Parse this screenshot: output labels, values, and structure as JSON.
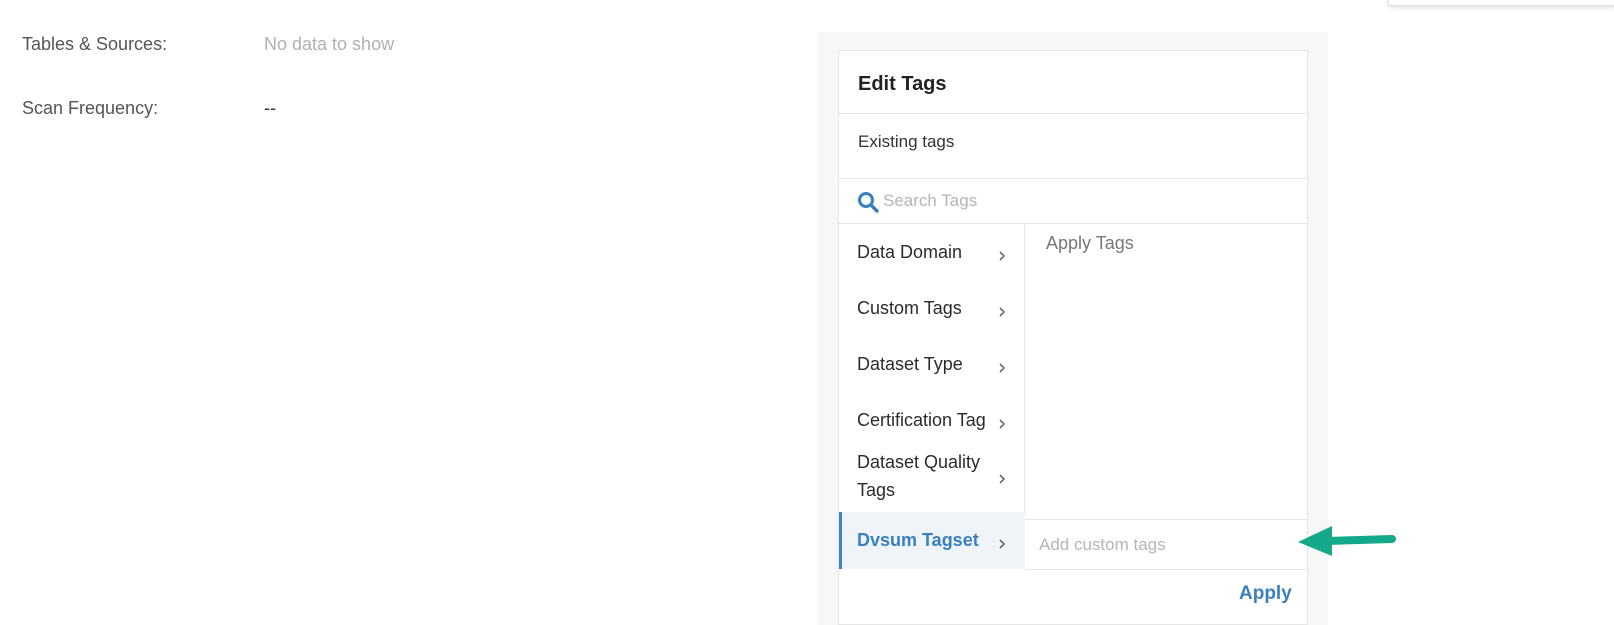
{
  "details": {
    "tables_sources_label": "Tables & Sources:",
    "tables_sources_value": "No data to show",
    "scan_frequency_label": "Scan Frequency:",
    "scan_frequency_value": "--"
  },
  "edit_tags": {
    "title": "Edit Tags",
    "existing_tags_label": "Existing tags",
    "search_placeholder": "Search Tags",
    "categories": [
      {
        "label": "Data Domain"
      },
      {
        "label": "Custom Tags"
      },
      {
        "label": "Dataset Type"
      },
      {
        "label": "Certification Tag"
      },
      {
        "label": "Dataset Quality Tags"
      },
      {
        "label": "Dvsum Tagset",
        "active": true
      }
    ],
    "apply_tags_title": "Apply Tags",
    "custom_tags_placeholder": "Add custom tags",
    "apply_label": "Apply"
  },
  "colors": {
    "accent": "#3a7fbf",
    "arrow": "#14a98b",
    "muted_text": "#b0b0b0"
  },
  "icons": {
    "search": "search-icon",
    "chevron": "chevron-right-icon",
    "arrow": "arrow-left-icon"
  }
}
